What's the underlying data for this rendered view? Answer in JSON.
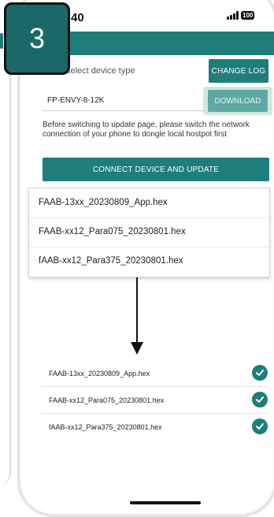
{
  "step": {
    "number": "3"
  },
  "status_bar": {
    "time": ":40",
    "battery": "100"
  },
  "form": {
    "select_label": "select device type",
    "changelog_label": "CHANGE LOG",
    "device_type": "FP-ENVY-8-12K",
    "download_label": "DOWNLOAD",
    "info": "Before switching to update page, please switch the network connection of your phone to dongle local hostpot first",
    "connect_label": "CONNECT DEVICE AND UPDATE"
  },
  "files": [
    {
      "name": "FAAB-13xx_20230809_App.hex"
    },
    {
      "name": "FAAB-xx12_Para075_20230801.hex"
    },
    {
      "name": "fAAB-xx12_Para375_20230801.hex"
    }
  ],
  "completed_files": [
    {
      "name": "FAAB-13xx_20230809_App.hex",
      "status": "done"
    },
    {
      "name": "FAAB-xx12_Para075_20230801.hex",
      "status": "done"
    },
    {
      "name": "fAAB-xx12_Para375_20230801.hex",
      "status": "done"
    }
  ],
  "colors": {
    "accent": "#1f7e79",
    "badge": "#1a6966",
    "download_disabled": "#5ea9a3"
  }
}
